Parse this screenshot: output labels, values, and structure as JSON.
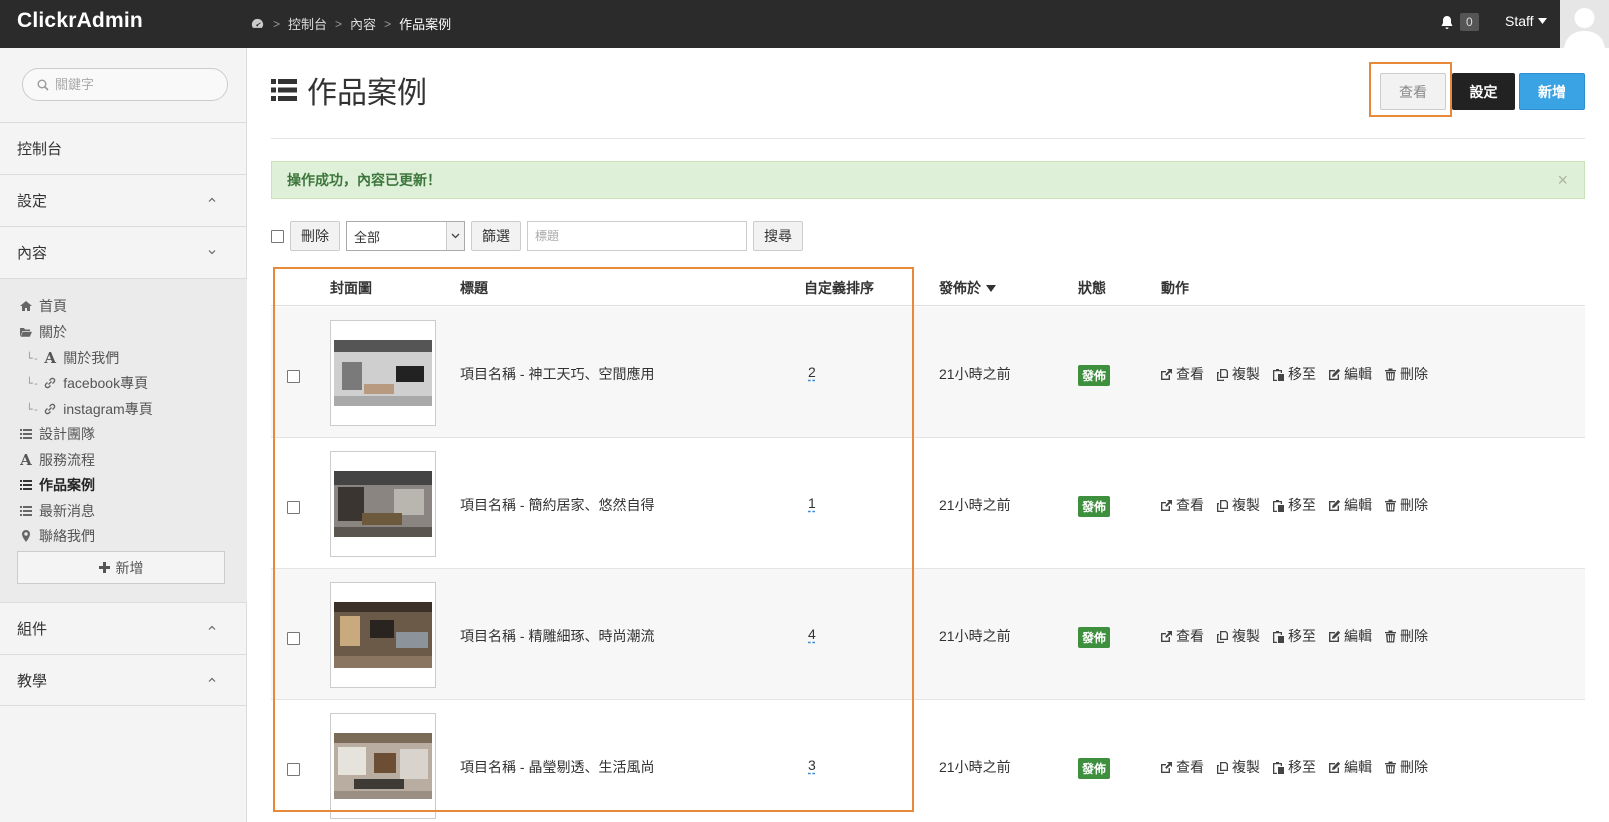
{
  "app": {
    "brand": "ClickrAdmin"
  },
  "breadcrumb": {
    "items": [
      "控制台",
      "內容",
      "作品案例"
    ]
  },
  "topbar": {
    "notifications": "0",
    "user": "Staff"
  },
  "sidebar": {
    "search_placeholder": "關鍵字",
    "sections": {
      "dashboard": "控制台",
      "settings": "設定",
      "content": "內容",
      "components": "組件",
      "tutorial": "教學"
    },
    "content_items": [
      {
        "label": "首頁",
        "icon": "home-icon"
      },
      {
        "label": "關於",
        "icon": "folder-open-icon"
      },
      {
        "label": "關於我們",
        "icon": "text-icon"
      },
      {
        "label": "facebook專頁",
        "icon": "link-icon"
      },
      {
        "label": "instagram專頁",
        "icon": "link-icon"
      },
      {
        "label": "設計團隊",
        "icon": "list-icon"
      },
      {
        "label": "服務流程",
        "icon": "text-icon"
      },
      {
        "label": "作品案例",
        "icon": "list-icon"
      },
      {
        "label": "最新消息",
        "icon": "list-icon"
      },
      {
        "label": "聯絡我們",
        "icon": "map-marker-icon"
      }
    ],
    "add_label": "新增"
  },
  "page": {
    "title": "作品案例"
  },
  "header_buttons": {
    "view": "查看",
    "settings": "設定",
    "new": "新增"
  },
  "alert": {
    "message": "操作成功，內容已更新！",
    "close": "×"
  },
  "toolbar": {
    "delete": "刪除",
    "filter_value": "全部",
    "filter_btn": "篩選",
    "title_placeholder": "標題",
    "search": "搜尋"
  },
  "table": {
    "headers": {
      "cover": "封面圖",
      "title": "標題",
      "order": "自定義排序",
      "published": "發佈於",
      "status": "狀態",
      "actions": "動作"
    },
    "actions": {
      "view": "查看",
      "copy": "複製",
      "move": "移至",
      "edit": "編輯",
      "delete": "刪除"
    },
    "rows": [
      {
        "title": "項目名稱 - 神工天巧、空間應用",
        "order": "2",
        "published": "21小時之前",
        "status": "發佈"
      },
      {
        "title": "項目名稱 - 簡約居家、悠然自得",
        "order": "1",
        "published": "21小時之前",
        "status": "發佈"
      },
      {
        "title": "項目名稱 - 精雕細琢、時尚潮流",
        "order": "4",
        "published": "21小時之前",
        "status": "發佈"
      },
      {
        "title": "項目名稱 - 晶瑩剔透、生活風尚",
        "order": "3",
        "published": "21小時之前",
        "status": "發佈"
      }
    ]
  },
  "colors": {
    "accent_blue": "#3aa3e3",
    "status_green": "#3e8f3e",
    "highlight_orange": "#e8893a",
    "topbar": "#2b2b2b"
  }
}
